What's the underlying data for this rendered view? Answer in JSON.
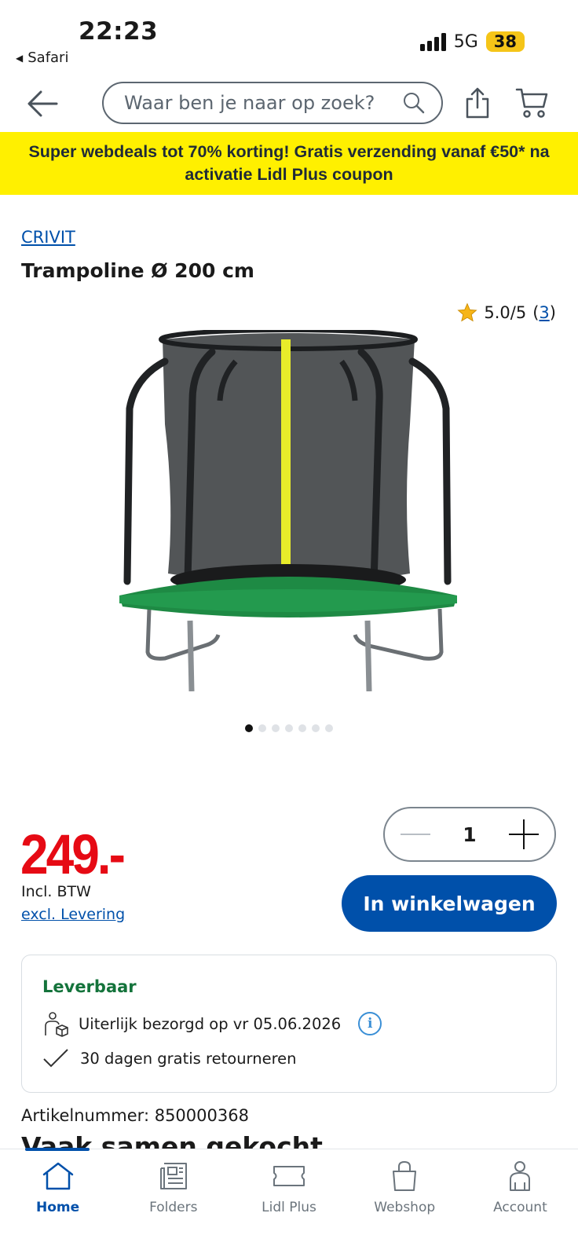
{
  "status_bar": {
    "time": "22:23",
    "back_app": "Safari",
    "network": "5G",
    "battery": "38"
  },
  "header": {
    "search_placeholder": "Waar ben je naar op zoek?"
  },
  "promo_banner": {
    "text": "Super webdeals tot 70% korting! Gratis verzending vanaf €50* na activatie Lidl Plus coupon"
  },
  "product": {
    "brand": "CRIVIT",
    "title": "Trampoline Ø 200 cm",
    "rating": "5.0/5",
    "rating_count": "3",
    "image_count": 7,
    "image_index": 1,
    "price": "249.-",
    "vat_note": "Incl. BTW",
    "delivery_link": "excl. Levering",
    "quantity": "1",
    "add_to_cart": "In winkelwagen",
    "availability": "Leverbaar",
    "delivery_date": "Uiterlijk bezorgd op vr 05.06.2026",
    "returns": "30 dagen gratis retourneren",
    "article_number": "Artikelnummer: 850000368"
  },
  "section": {
    "heading": "Vaak samen gekocht"
  },
  "tabbar": {
    "items": [
      {
        "label": "Home",
        "icon": "home-icon",
        "active": true
      },
      {
        "label": "Folders",
        "icon": "folders-icon",
        "active": false
      },
      {
        "label": "Lidl Plus",
        "icon": "ticket-icon",
        "active": false
      },
      {
        "label": "Webshop",
        "icon": "shopping-bag-icon",
        "active": false
      },
      {
        "label": "Account",
        "icon": "account-icon",
        "active": false
      }
    ]
  },
  "colors": {
    "brand_blue": "#0050aa",
    "promo_yellow": "#fff000",
    "price_red": "#e60a14",
    "available_green": "#14733b"
  }
}
